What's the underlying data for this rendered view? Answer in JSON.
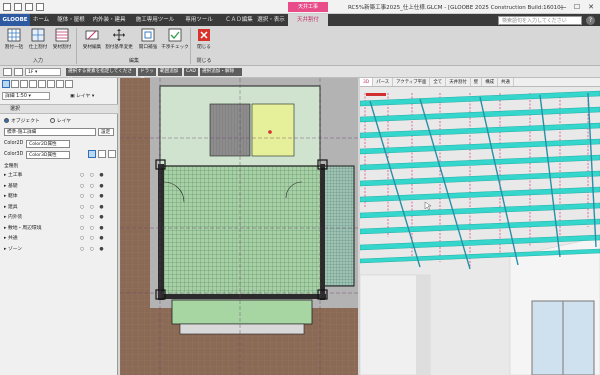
{
  "window": {
    "context_label": "天井工事",
    "title": "RC5%新築工事2025_仕上仕様.GLCM - [GLOOBE 2025 Construction Build:16010]",
    "min": "—",
    "max": "☐",
    "close": "✕"
  },
  "ribbon_tabs": [
    {
      "label": "GLOOBE"
    },
    {
      "label": "ホーム"
    },
    {
      "label": "躯体・屋根"
    },
    {
      "label": "内外装・建具"
    },
    {
      "label": "施工専用ツール"
    },
    {
      "label": "専用ツール"
    },
    {
      "label": "ＣＡＤ編集"
    },
    {
      "label": "選択・表示"
    },
    {
      "label": "天井割付"
    }
  ],
  "search_placeholder": "検索語句を入力してください",
  "ribbon_groups": [
    {
      "label": "入力",
      "buttons": [
        "割付一括",
        "仕上割付",
        "受材割付"
      ]
    },
    {
      "label": "編集",
      "buttons": [
        "受材編集",
        "割付基準変更",
        "開口補強",
        "干渉チェック"
      ]
    },
    {
      "label": "閉じる",
      "buttons": [
        "閉じる"
      ]
    }
  ],
  "subbar": {
    "floor": "1F",
    "items": [
      "選択する要素を指定してください",
      "ドラッグ",
      "範囲追加",
      "CAD",
      "選択追加・解除"
    ]
  },
  "left_panel": {
    "scale": "1:50",
    "scale_label": "詳細",
    "layer_label": "レイヤ",
    "selection_title": "選択",
    "radio_object": "オブジェクト",
    "radio_layer": "レイヤ",
    "preset": "標準-施工詳細",
    "preset_button": "設定",
    "color2d_label": "Color2D",
    "color2d_value": "Color2D属性",
    "color3d_label": "Color3D",
    "color3d_value": "Color3D属性",
    "tree_root": "全種別",
    "tree_items": [
      {
        "label": "土工事"
      },
      {
        "label": "基礎"
      },
      {
        "label": "躯体"
      },
      {
        "label": "建具"
      },
      {
        "label": "内外装"
      },
      {
        "label": "敷地・周辺環境"
      },
      {
        "label": "共通"
      },
      {
        "label": "ゾーン"
      }
    ],
    "tree_marks": "○ ○ ●"
  },
  "view3d_tabs": [
    "3D",
    "パース",
    "アクティブ平面",
    "全て",
    "天井割付",
    "壁",
    "構成",
    "共通"
  ],
  "colors": {
    "accent": "#e84d8a",
    "ribbon_dark": "#3a3a3a",
    "tile_green": "#8fbf90",
    "beam_cyan": "#35d7cc"
  }
}
